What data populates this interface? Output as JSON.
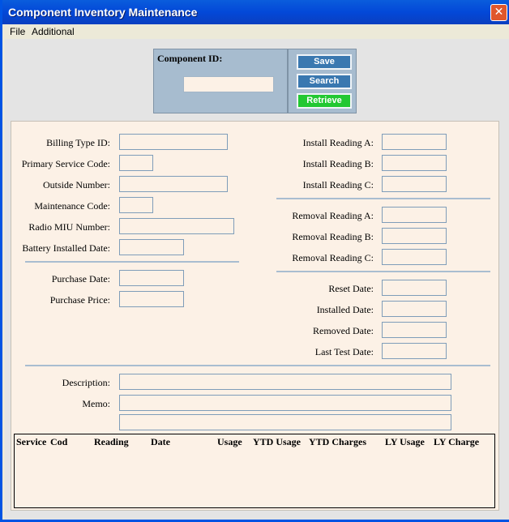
{
  "window": {
    "title": "Component Inventory Maintenance",
    "close_glyph": "✕"
  },
  "menu": [
    "File",
    "Additional"
  ],
  "component": {
    "label": "Component ID:",
    "value": ""
  },
  "buttons": {
    "save": "Save",
    "search": "Search",
    "retrieve": "Retrieve"
  },
  "left_fields": [
    {
      "label": "Billing Type ID:",
      "value": ""
    },
    {
      "label": "Primary Service Code:",
      "value": ""
    },
    {
      "label": "Outside Number:",
      "value": ""
    },
    {
      "label": "Maintenance Code:",
      "value": ""
    },
    {
      "label": "Radio MIU Number:",
      "value": ""
    },
    {
      "label": "Battery Installed Date:",
      "value": ""
    },
    {
      "label": "Purchase Date:",
      "value": ""
    },
    {
      "label": "Purchase Price:",
      "value": ""
    }
  ],
  "right_fields": [
    {
      "label": "Install Reading A:",
      "value": ""
    },
    {
      "label": "Install Reading B:",
      "value": ""
    },
    {
      "label": "Install Reading C:",
      "value": ""
    },
    {
      "label": "Removal Reading A:",
      "value": ""
    },
    {
      "label": "Removal Reading B:",
      "value": ""
    },
    {
      "label": "Removal Reading C:",
      "value": ""
    },
    {
      "label": "Reset Date:",
      "value": ""
    },
    {
      "label": "Installed Date:",
      "value": ""
    },
    {
      "label": "Removed Date:",
      "value": ""
    },
    {
      "label": "Last Test Date:",
      "value": ""
    }
  ],
  "description": {
    "label": "Description:",
    "value": ""
  },
  "memo": {
    "label": "Memo:",
    "value": "",
    "value2": ""
  },
  "grid_columns": [
    "Service",
    "Cod",
    "Reading",
    "Date",
    "Usage",
    "YTD Usage",
    "YTD Charges",
    "LY Usage",
    "LY Charge"
  ]
}
